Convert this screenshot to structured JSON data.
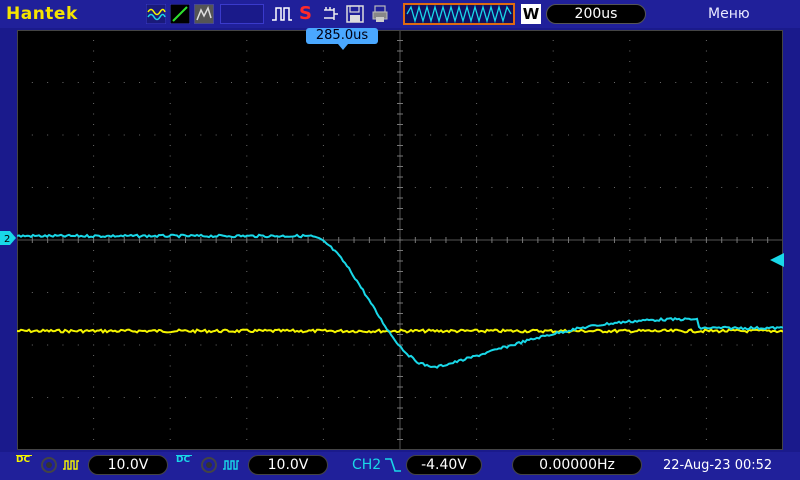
{
  "brand": "Hantek",
  "top": {
    "save_badge": "S",
    "mode_badge": "W",
    "timebase": "200us",
    "menu": "Меню",
    "trigger_position": "285.0us"
  },
  "bottom": {
    "ch1": {
      "coupling": "DC",
      "volts_per_div": "10.0V"
    },
    "ch2": {
      "coupling": "DC",
      "volts_per_div": "10.0V"
    },
    "trigger_source": "CH2",
    "trigger_level": "-4.40V",
    "frequency": "0.00000Hz",
    "datetime": "22-Aug-23 00:52"
  },
  "colors": {
    "ch1": "#f5f500",
    "ch2": "#19d8e8",
    "brand": "#f5e400",
    "grid": "#7a7a7a"
  },
  "icons": {
    "ch1_marker": "ch1-marker-icon",
    "ch2_marker": "ch2-marker-icon",
    "trigger_level_marker": "trigger-level-arrow-icon"
  }
}
